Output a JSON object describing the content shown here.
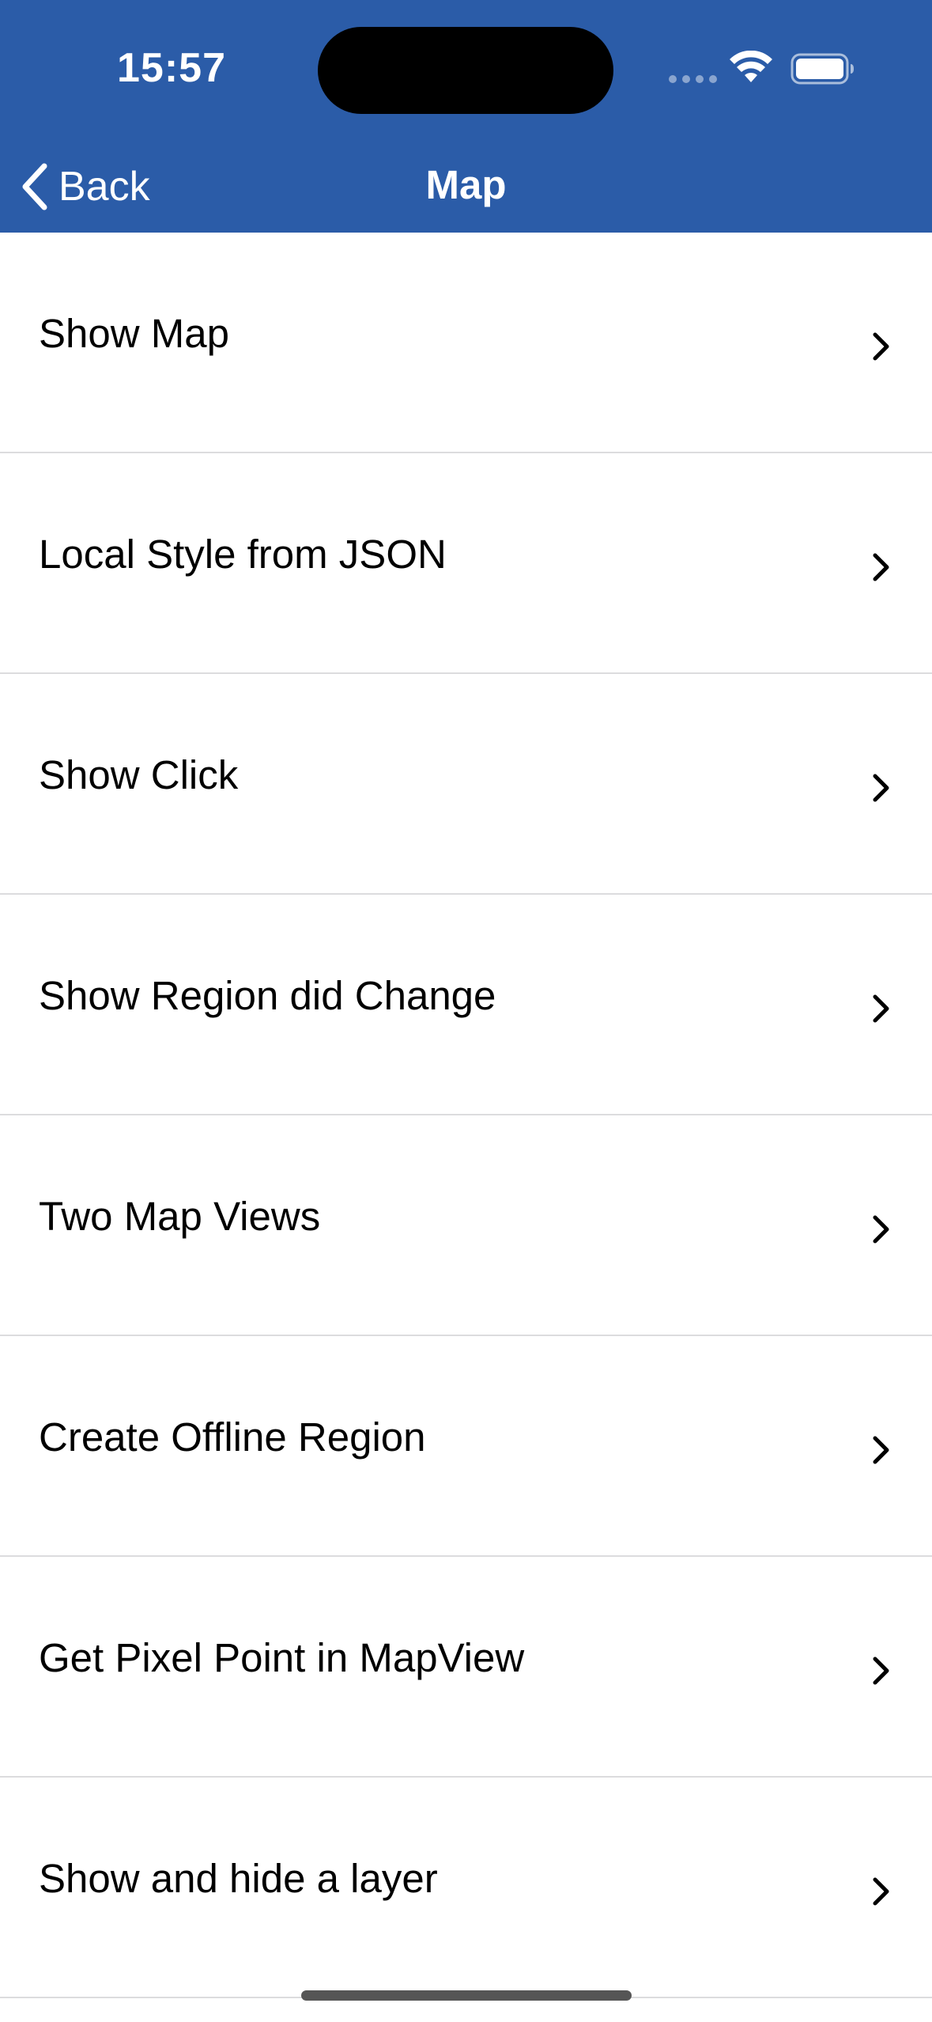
{
  "status_bar": {
    "time": "15:57"
  },
  "nav": {
    "back_label": "Back",
    "title": "Map"
  },
  "colors": {
    "header_bg": "#2b5ca8",
    "separator": "#dcdcde"
  },
  "items": [
    {
      "label": "Show Map"
    },
    {
      "label": "Local Style from JSON"
    },
    {
      "label": "Show Click"
    },
    {
      "label": "Show Region did Change"
    },
    {
      "label": "Two Map Views"
    },
    {
      "label": "Create Offline Region"
    },
    {
      "label": "Get Pixel Point in MapView"
    },
    {
      "label": "Show and hide a layer"
    }
  ]
}
